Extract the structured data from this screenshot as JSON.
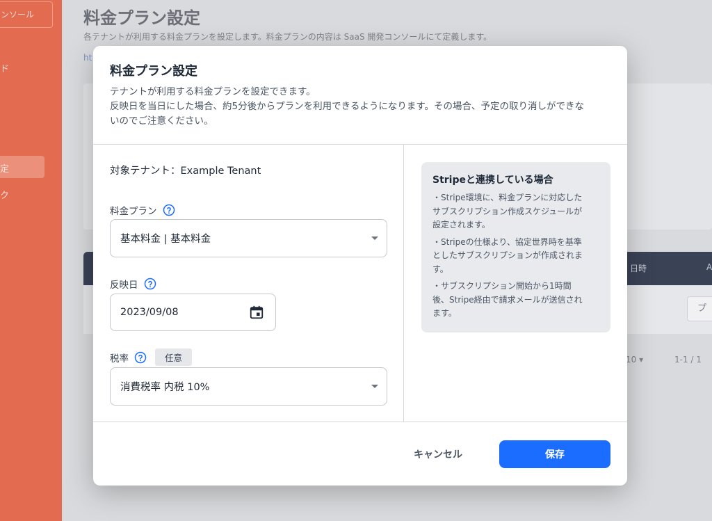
{
  "background": {
    "sidebar": {
      "console_label": "ンソール",
      "items": [
        "ド",
        "定",
        "ク"
      ]
    },
    "page_title": "料金プラン設定",
    "page_description": "各テナントが利用する料金プランを設定します。料金プランの内容は SaaS 開発コンソールにて定義します。",
    "link_text": "ht",
    "table_headers": [
      "日時",
      "A"
    ],
    "row_button_label": "プ",
    "pager": {
      "rows_per_page": "10 ▾",
      "range": "1-1 / 1"
    }
  },
  "modal": {
    "title": "料金プラン設定",
    "description_lines": [
      "テナントが利用する料金プランを設定できます。",
      "反映日を当日にした場合、約5分後からプランを利用できるようになります。その場合、予定の取り消しができな",
      "いのでご注意ください。"
    ],
    "target_tenant": "対象テナント：Example Tenant",
    "fields": {
      "plan": {
        "label": "料金プラン",
        "value": "基本料金 | 基本料金"
      },
      "effective_date": {
        "label": "反映日",
        "value": "2023/09/08"
      },
      "tax_rate": {
        "label": "税率",
        "badge": "任意",
        "value": "消費税率 内税 10%"
      }
    },
    "info": {
      "title": "Stripeと連携している場合",
      "items": [
        [
          "・Stripe環境に、料金プランに対応した",
          "サブスクリプション作成スケジュールが",
          "設定されます。"
        ],
        [
          "・Stripeの仕様より、協定世界時を基準",
          "としたサブスクリプションが作成されま",
          "す。"
        ],
        [
          "・サブスクリプション開始から1時間",
          "後、Stripe経由で請求メールが送信され",
          "ます。"
        ]
      ]
    },
    "buttons": {
      "cancel": "キャンセル",
      "save": "保存"
    }
  },
  "colors": {
    "accent": "#1a6dff",
    "sidebar": "#e36b4f",
    "help_icon": "#1a6dff"
  }
}
